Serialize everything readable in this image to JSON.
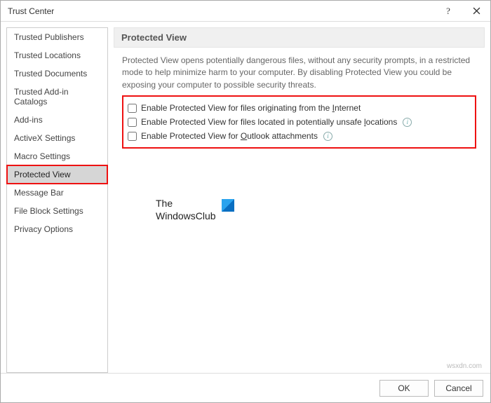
{
  "window": {
    "title": "Trust Center"
  },
  "sidebar": {
    "items": [
      {
        "label": "Trusted Publishers"
      },
      {
        "label": "Trusted Locations"
      },
      {
        "label": "Trusted Documents"
      },
      {
        "label": "Trusted Add-in Catalogs"
      },
      {
        "label": "Add-ins"
      },
      {
        "label": "ActiveX Settings"
      },
      {
        "label": "Macro Settings"
      },
      {
        "label": "Protected View"
      },
      {
        "label": "Message Bar"
      },
      {
        "label": "File Block Settings"
      },
      {
        "label": "Privacy Options"
      }
    ],
    "selected_index": 7
  },
  "main": {
    "section_title": "Protected View",
    "description": "Protected View opens potentially dangerous files, without any security prompts, in a restricted mode to help minimize harm to your computer. By disabling Protected View you could be exposing your computer to possible security threats.",
    "options": [
      {
        "label_pre": "Enable Protected View for files originating from the ",
        "accel": "I",
        "label_post": "nternet",
        "checked": false,
        "info": false
      },
      {
        "label_pre": "Enable Protected View for files located in potentially unsafe ",
        "accel": "l",
        "label_post": "ocations",
        "checked": false,
        "info": true
      },
      {
        "label_pre": "Enable Protected View for ",
        "accel": "O",
        "label_post": "utlook attachments",
        "checked": false,
        "info": true
      }
    ]
  },
  "logo": {
    "line1": "The",
    "line2": "WindowsClub"
  },
  "footer": {
    "ok": "OK",
    "cancel": "Cancel"
  },
  "watermark": "wsxdn.com"
}
